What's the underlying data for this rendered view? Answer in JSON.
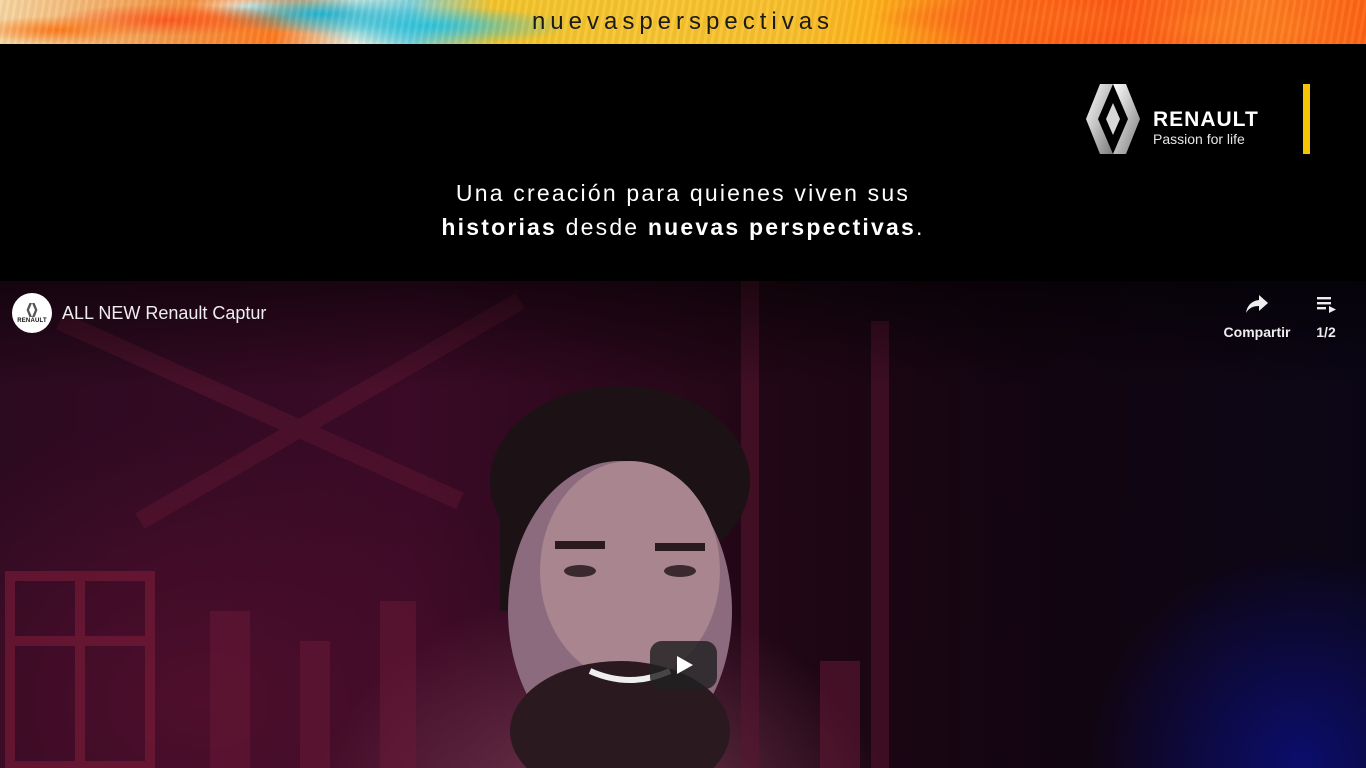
{
  "banner": {
    "title": "nuevasperspectivas"
  },
  "logo": {
    "brand": "RENAULT",
    "tagline": "Passion for life",
    "accent_color": "#f6c400"
  },
  "intro": {
    "line1": "Una creación para quienes viven sus",
    "line2_bold1": "historias",
    "line2_mid": " desde ",
    "line2_bold2": "nuevas perspectivas",
    "line2_end": "."
  },
  "video": {
    "channel_avatar_text": "RENAULT",
    "title": "ALL NEW Renault Captur",
    "share_label": "Compartir",
    "playlist_label": "1/2",
    "icons": {
      "share": "share-icon",
      "playlist": "playlist-icon",
      "play": "play-icon"
    }
  }
}
